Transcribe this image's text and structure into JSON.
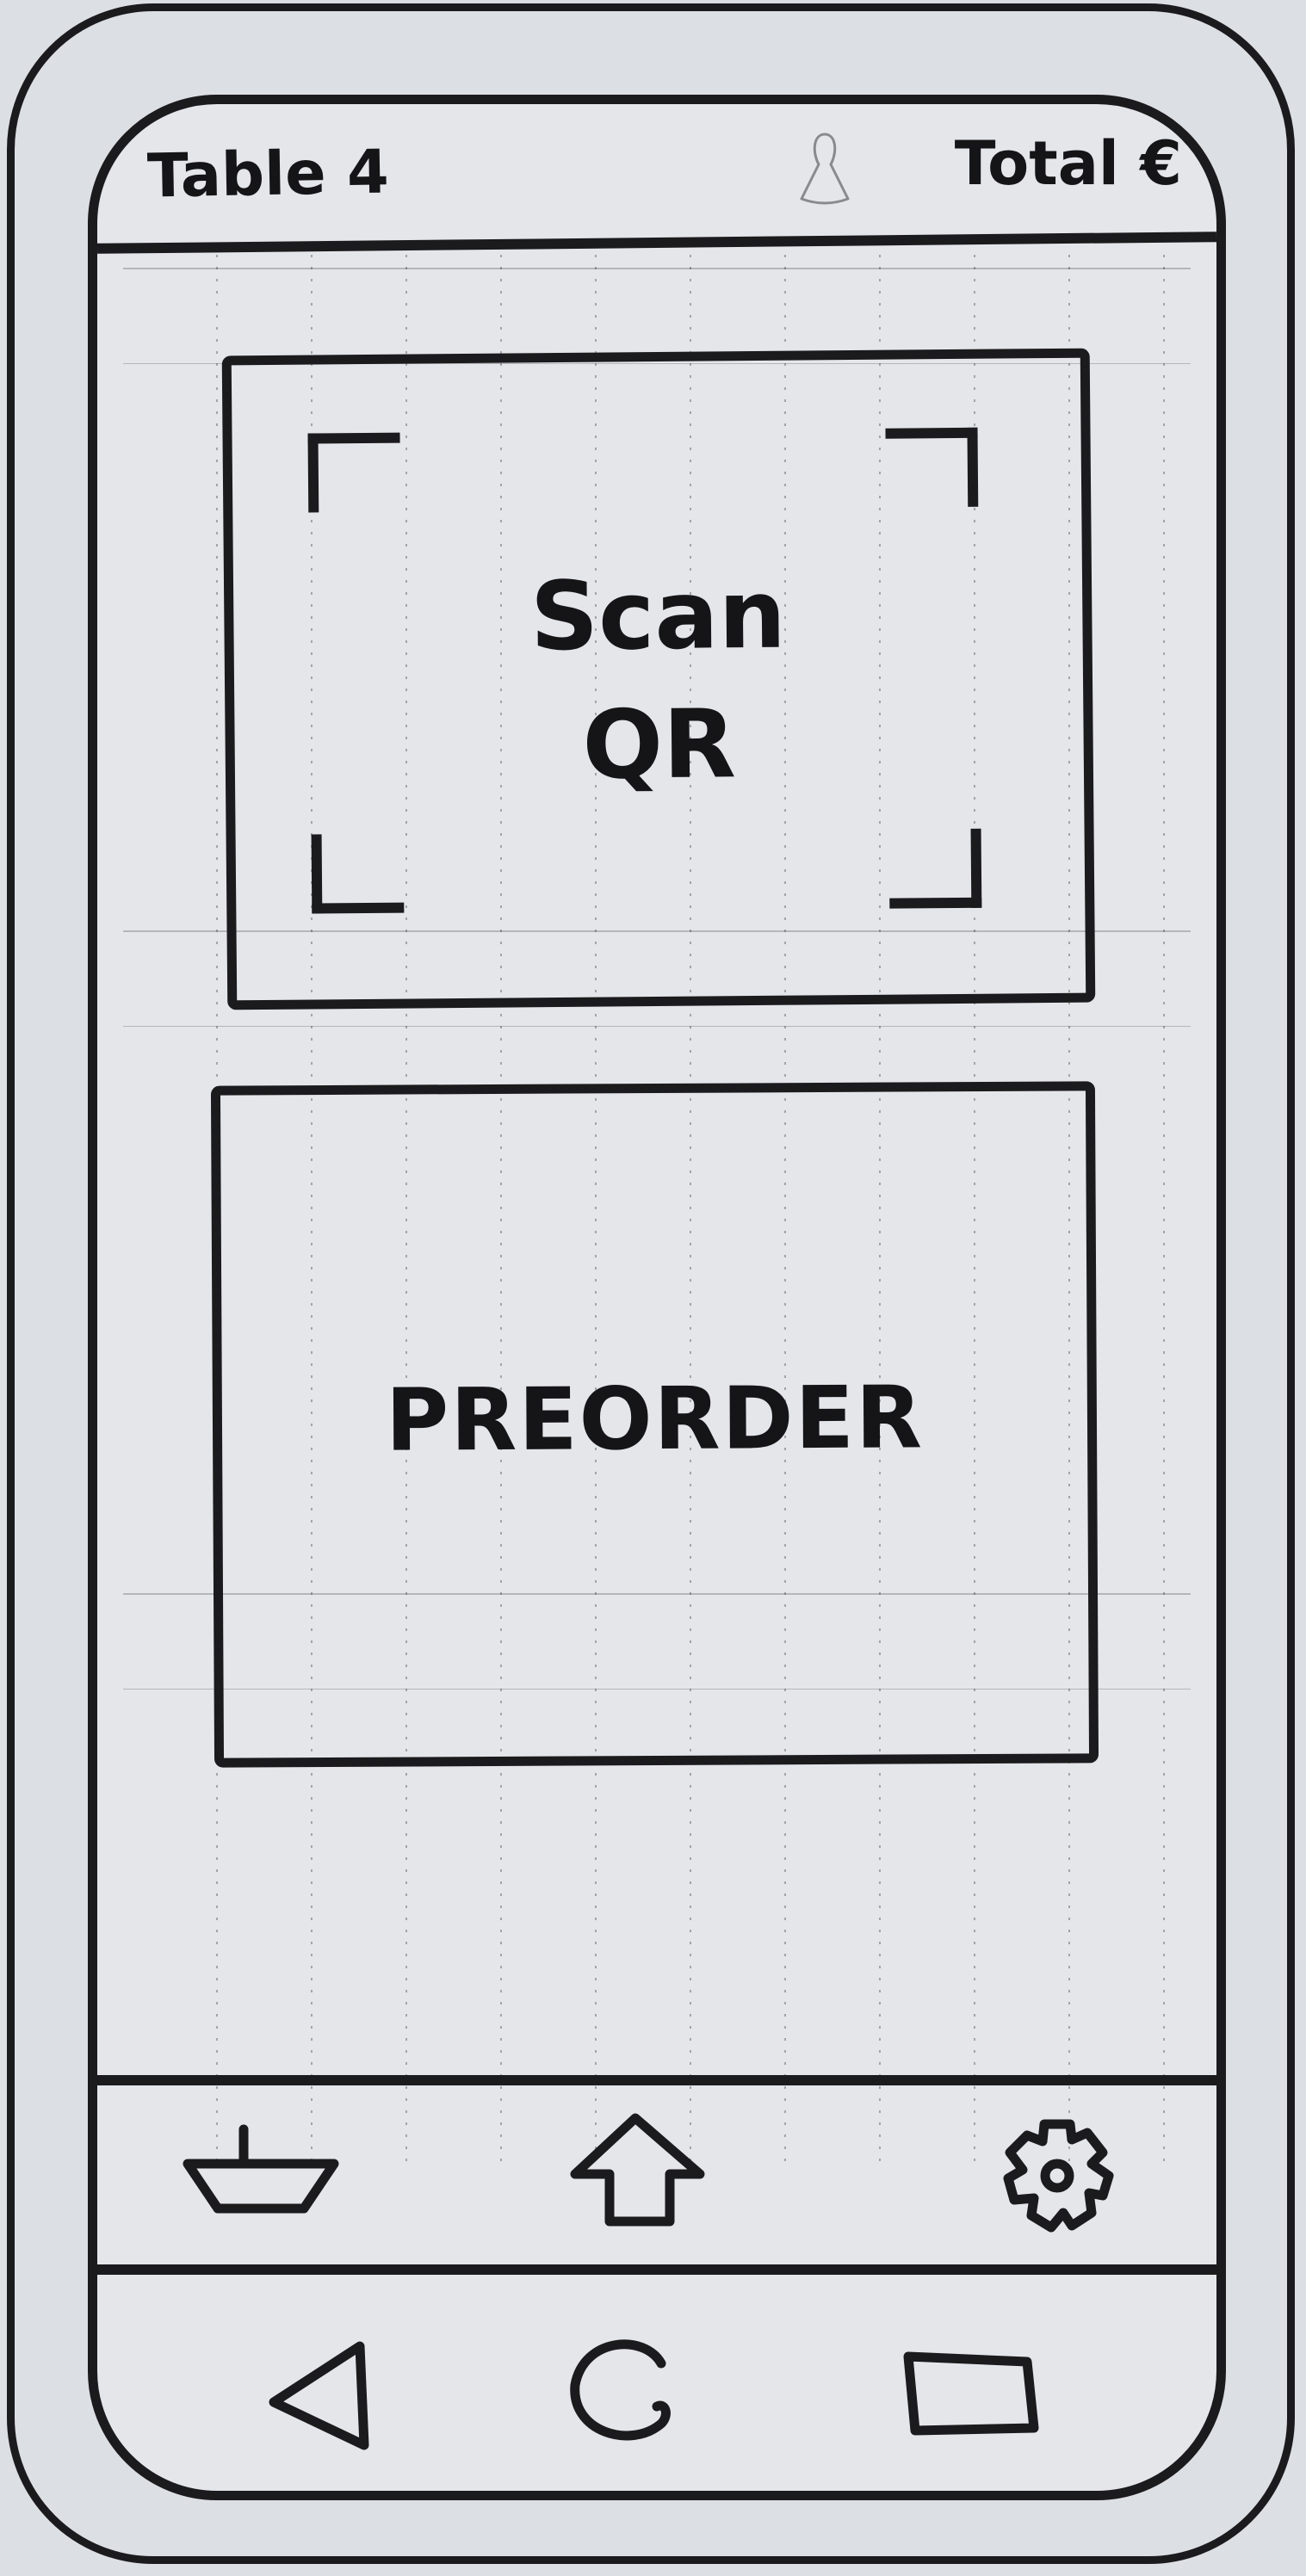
{
  "header": {
    "title": "Table 4",
    "total_label": "Total €",
    "user_icon": "user-icon"
  },
  "main": {
    "scan_button": {
      "label_line1": "Scan",
      "label_line2": "QR",
      "icon": "qr-scan-frame-icon"
    },
    "preorder_button": {
      "label": "PREORDER"
    }
  },
  "bottom_nav": {
    "items": [
      {
        "icon": "basket-icon"
      },
      {
        "icon": "home-icon"
      },
      {
        "icon": "gear-icon"
      }
    ]
  },
  "system_nav": {
    "items": [
      {
        "icon": "back-icon"
      },
      {
        "icon": "home-circle-icon"
      },
      {
        "icon": "recents-square-icon"
      }
    ]
  }
}
